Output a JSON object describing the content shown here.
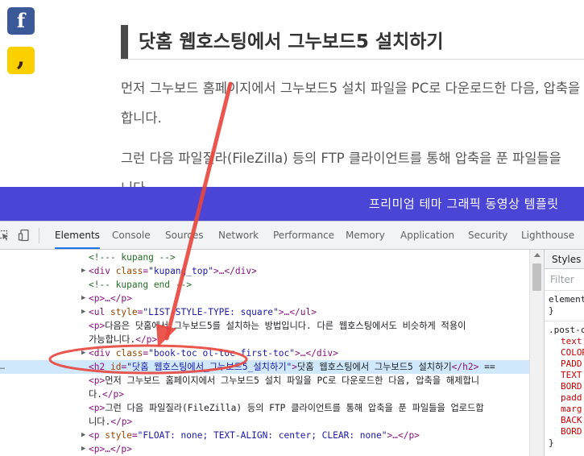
{
  "blog": {
    "share_facebook": "f",
    "share_kakao": ",",
    "title": "닷홈 웹호스팅에서 그누보드5 설치하기",
    "para1_line1": "먼저 그누보드 홈페이지에서 그누보드5 설치 파일을 PC로 다운로드한 다음, 압축을",
    "para1_line2": "합니다.",
    "para2_line1": "그런 다음 파일질라(FileZilla) 등의 FTP 클라이언트를 통해 압축을 푼 파일들을",
    "para2_line2": "니다."
  },
  "menubar": {
    "items": "프리미엄 테마 그래픽 동영상 템플릿"
  },
  "devtools": {
    "tabs": [
      "Elements",
      "Console",
      "Sources",
      "Network",
      "Performance",
      "Memory",
      "Application",
      "Security",
      "Lighthouse"
    ],
    "active_tab": "Elements",
    "dom": {
      "l1": "<!--- kupang -->",
      "l2_open": "<div ",
      "l2_attr": "class",
      "l2_val": "\"kupang_top\"",
      "l2_close": ">…</div>",
      "l3": "<!-- kupang end -->",
      "l4": "<p>…</p>",
      "l5_open": "<ul ",
      "l5_attr": "style",
      "l5_val": "\"LIST-STYLE-TYPE: square\"",
      "l5_close": ">…</ul>",
      "l6_a": "<p>",
      "l6_b": "다음은 닷홈에서 그누보드5를 설치하는 방법입니다. 다른 웹호스팅에서도 비슷하게 적용이",
      "l7": "가능합니다.",
      "l7_close": "</p>",
      "l8_open": "<div ",
      "l8_attr": "class",
      "l8_val": "\"book-toc ol-toc first-toc\"",
      "l8_close": ">…</div>",
      "l9_open": "<h2 ",
      "l9_attr": "id",
      "l9_val": "\"닷홈_웹호스팅에서_그누보드5_설치하기\"",
      "l9_gt": ">",
      "l9_text": "닷홈 웹호스팅에서 그누보드5 설치하기",
      "l9_close": "</h2>",
      "l9_tail": " ==",
      "l10_a": "<p>",
      "l10_b": "먼저 그누보드 홈페이지에서 그누보드5 설치 파일을 PC로 다운로드한 다음, 압축을 해제합니",
      "l11_a": "다.",
      "l11_close": "</p>",
      "l12_a": "<p>",
      "l12_b": "그런 다음 파일질라(FileZilla) 등의 FTP 클라이언트를 통해 압축을 푼 파일들을 업로드합",
      "l13_a": "니다.",
      "l13_close": "</p>",
      "l14_open": "<p ",
      "l14_attr": "style",
      "l14_val": "\"FLOAT: none; TEXT-ALIGN: center; CLEAR: none\"",
      "l14_close": ">…</p>",
      "l15": "<p>…</p>"
    },
    "styles": {
      "tab": "Styles",
      "filter": "Filter",
      "s1": "element",
      "s2": "}",
      "s3": ".post-c",
      "p1": "text",
      "p2": "COLOR",
      "p3": "PADD",
      "p4": "TEXT",
      "p5": "BORD",
      "p6": "padd",
      "p7": "marg",
      "p8": "BACK",
      "p9": "BORD",
      "s4": "}"
    }
  },
  "colors": {
    "menubar": "#4a45d5",
    "annotation": "#e8453c",
    "selection": "#cfe8fc",
    "active_tab_underline": "#1a73e8"
  }
}
